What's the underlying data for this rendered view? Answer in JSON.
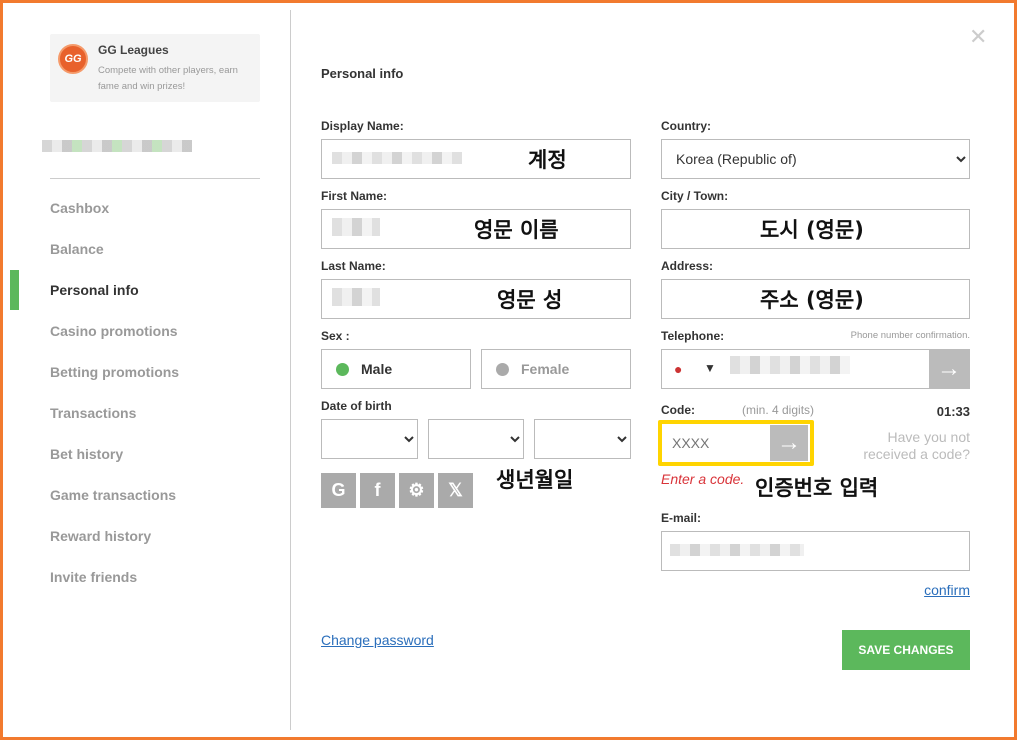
{
  "promo": {
    "title": "GG Leagues",
    "description": "Compete with other players, earn fame and win prizes!",
    "logo_text": "GG"
  },
  "sidebar": {
    "items": [
      {
        "label": "Cashbox"
      },
      {
        "label": "Balance"
      },
      {
        "label": "Personal info",
        "active": true
      },
      {
        "label": "Casino promotions"
      },
      {
        "label": "Betting promotions"
      },
      {
        "label": "Transactions"
      },
      {
        "label": "Bet history"
      },
      {
        "label": "Game transactions"
      },
      {
        "label": "Reward history"
      },
      {
        "label": "Invite friends"
      }
    ]
  },
  "page_title": "Personal info",
  "form": {
    "display_name_label": "Display Name:",
    "first_name_label": "First Name:",
    "last_name_label": "Last Name:",
    "sex_label": "Sex :",
    "sex_options": [
      "Male",
      "Female"
    ],
    "sex_selected": "Male",
    "dob_label": "Date of birth",
    "country_label": "Country:",
    "country_value": "Korea (Republic of)",
    "city_label": "City / Town:",
    "address_label": "Address:",
    "telephone_label": "Telephone:",
    "telephone_hint": "Phone number confirmation.",
    "code_label": "Code:",
    "code_hint": "(min. 4 digits)",
    "code_timer": "01:33",
    "code_placeholder": "XXXX",
    "code_error": "Enter a code.",
    "resend_text": "Have you not received a code?",
    "email_label": "E-mail:",
    "confirm_link": "confirm",
    "change_password": "Change password",
    "save_button": "SAVE CHANGES"
  },
  "social": [
    {
      "icon": "google-icon",
      "glyph": "G"
    },
    {
      "icon": "facebook-icon",
      "glyph": "f"
    },
    {
      "icon": "steam-icon",
      "glyph": "⚙"
    },
    {
      "icon": "x-icon",
      "glyph": "𝕏"
    }
  ],
  "annotations": {
    "display_name": "계정",
    "first_name": "영문 이름",
    "last_name": "영문 성",
    "city": "도시 (영문)",
    "address": "주소 (영문)",
    "dob": "생년월일",
    "code": "인증번호 입력"
  },
  "colors": {
    "accent": "#5cb85c",
    "highlight": "#ffd400",
    "error": "#d9343a",
    "frame": "#f27a2e"
  }
}
